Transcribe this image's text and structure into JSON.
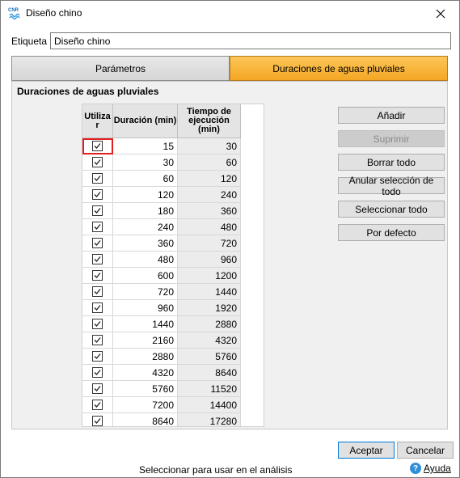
{
  "window": {
    "title": "Diseño chino",
    "app_icon_text": "CNR"
  },
  "form": {
    "label": "Etiqueta",
    "value": "Diseño chino"
  },
  "tabs": [
    {
      "label": "Parámetros",
      "active": false
    },
    {
      "label": "Duraciones de aguas pluviales",
      "active": true
    }
  ],
  "panel": {
    "title": "Duraciones de aguas pluviales"
  },
  "table": {
    "headers": {
      "use": "Utiliza r",
      "duration": "Duración (min)",
      "exec": "Tiempo de ejecución (min)"
    },
    "rows": [
      {
        "checked": true,
        "duration": "15",
        "exec": "30"
      },
      {
        "checked": true,
        "duration": "30",
        "exec": "60"
      },
      {
        "checked": true,
        "duration": "60",
        "exec": "120"
      },
      {
        "checked": true,
        "duration": "120",
        "exec": "240"
      },
      {
        "checked": true,
        "duration": "180",
        "exec": "360"
      },
      {
        "checked": true,
        "duration": "240",
        "exec": "480"
      },
      {
        "checked": true,
        "duration": "360",
        "exec": "720"
      },
      {
        "checked": true,
        "duration": "480",
        "exec": "960"
      },
      {
        "checked": true,
        "duration": "600",
        "exec": "1200"
      },
      {
        "checked": true,
        "duration": "720",
        "exec": "1440"
      },
      {
        "checked": true,
        "duration": "960",
        "exec": "1920"
      },
      {
        "checked": true,
        "duration": "1440",
        "exec": "2880"
      },
      {
        "checked": true,
        "duration": "2160",
        "exec": "4320"
      },
      {
        "checked": true,
        "duration": "2880",
        "exec": "5760"
      },
      {
        "checked": true,
        "duration": "4320",
        "exec": "8640"
      },
      {
        "checked": true,
        "duration": "5760",
        "exec": "11520"
      },
      {
        "checked": true,
        "duration": "7200",
        "exec": "14400"
      },
      {
        "checked": true,
        "duration": "8640",
        "exec": "17280"
      }
    ]
  },
  "side_buttons": [
    {
      "label": "Añadir",
      "enabled": true
    },
    {
      "label": "Suprimir",
      "enabled": false
    },
    {
      "label": "Borrar todo",
      "enabled": true
    },
    {
      "label": "Anular selección de todo",
      "enabled": true
    },
    {
      "label": "Seleccionar todo",
      "enabled": true
    },
    {
      "label": "Por defecto",
      "enabled": true
    }
  ],
  "footer": {
    "ok_label": "Aceptar",
    "cancel_label": "Cancelar",
    "status": "Seleccionar para usar en el análisis",
    "help_label": "Ayuda"
  },
  "colors": {
    "active_tab": "#f5a623",
    "selection_outline": "#e02020",
    "help_icon": "#2f8fd6"
  }
}
